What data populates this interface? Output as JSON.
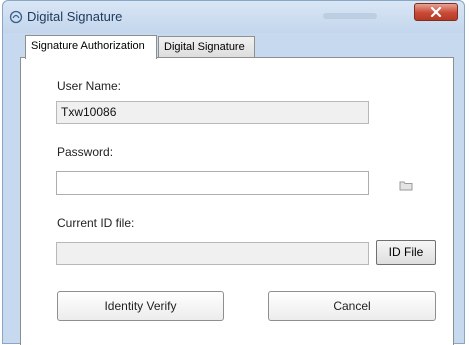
{
  "window": {
    "title": "Digital Signature",
    "close_icon": "close-icon",
    "app_icon": "signature-icon"
  },
  "tabs": [
    {
      "label": "Signature Authorization",
      "active": true
    },
    {
      "label": "Digital Signature",
      "active": false
    }
  ],
  "form": {
    "username_label": "User Name:",
    "username_value": "Txw10086",
    "password_label": "Password:",
    "password_value": "",
    "password_icon": "folder-icon",
    "id_file_label": "Current ID file:",
    "id_file_value": "",
    "id_file_button": "ID File"
  },
  "actions": {
    "verify_label": "Identity Verify",
    "cancel_label": "Cancel"
  },
  "colors": {
    "window_frame": "#c6d9ee",
    "close_button": "#c94a36",
    "panel_bg": "#ffffff"
  }
}
